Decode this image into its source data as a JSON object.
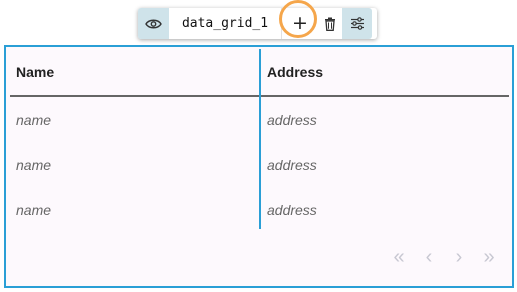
{
  "toolbar": {
    "component_name": "data_grid_1",
    "add_label": "+",
    "icons": [
      "eye-icon",
      "plus-icon",
      "trash-icon",
      "sliders-icon"
    ],
    "accent_color": "#cfe3ea",
    "highlight_color": "#f5a64b"
  },
  "grid": {
    "border_color": "#2a9fd6",
    "columns": [
      {
        "key": "name",
        "label": "Name"
      },
      {
        "key": "address",
        "label": "Address"
      }
    ],
    "rows": [
      {
        "name": "name",
        "address": "address"
      },
      {
        "name": "name",
        "address": "address"
      },
      {
        "name": "name",
        "address": "address"
      }
    ]
  },
  "pager": {
    "first": "«",
    "prev": "‹",
    "next": "›",
    "last": "»"
  }
}
